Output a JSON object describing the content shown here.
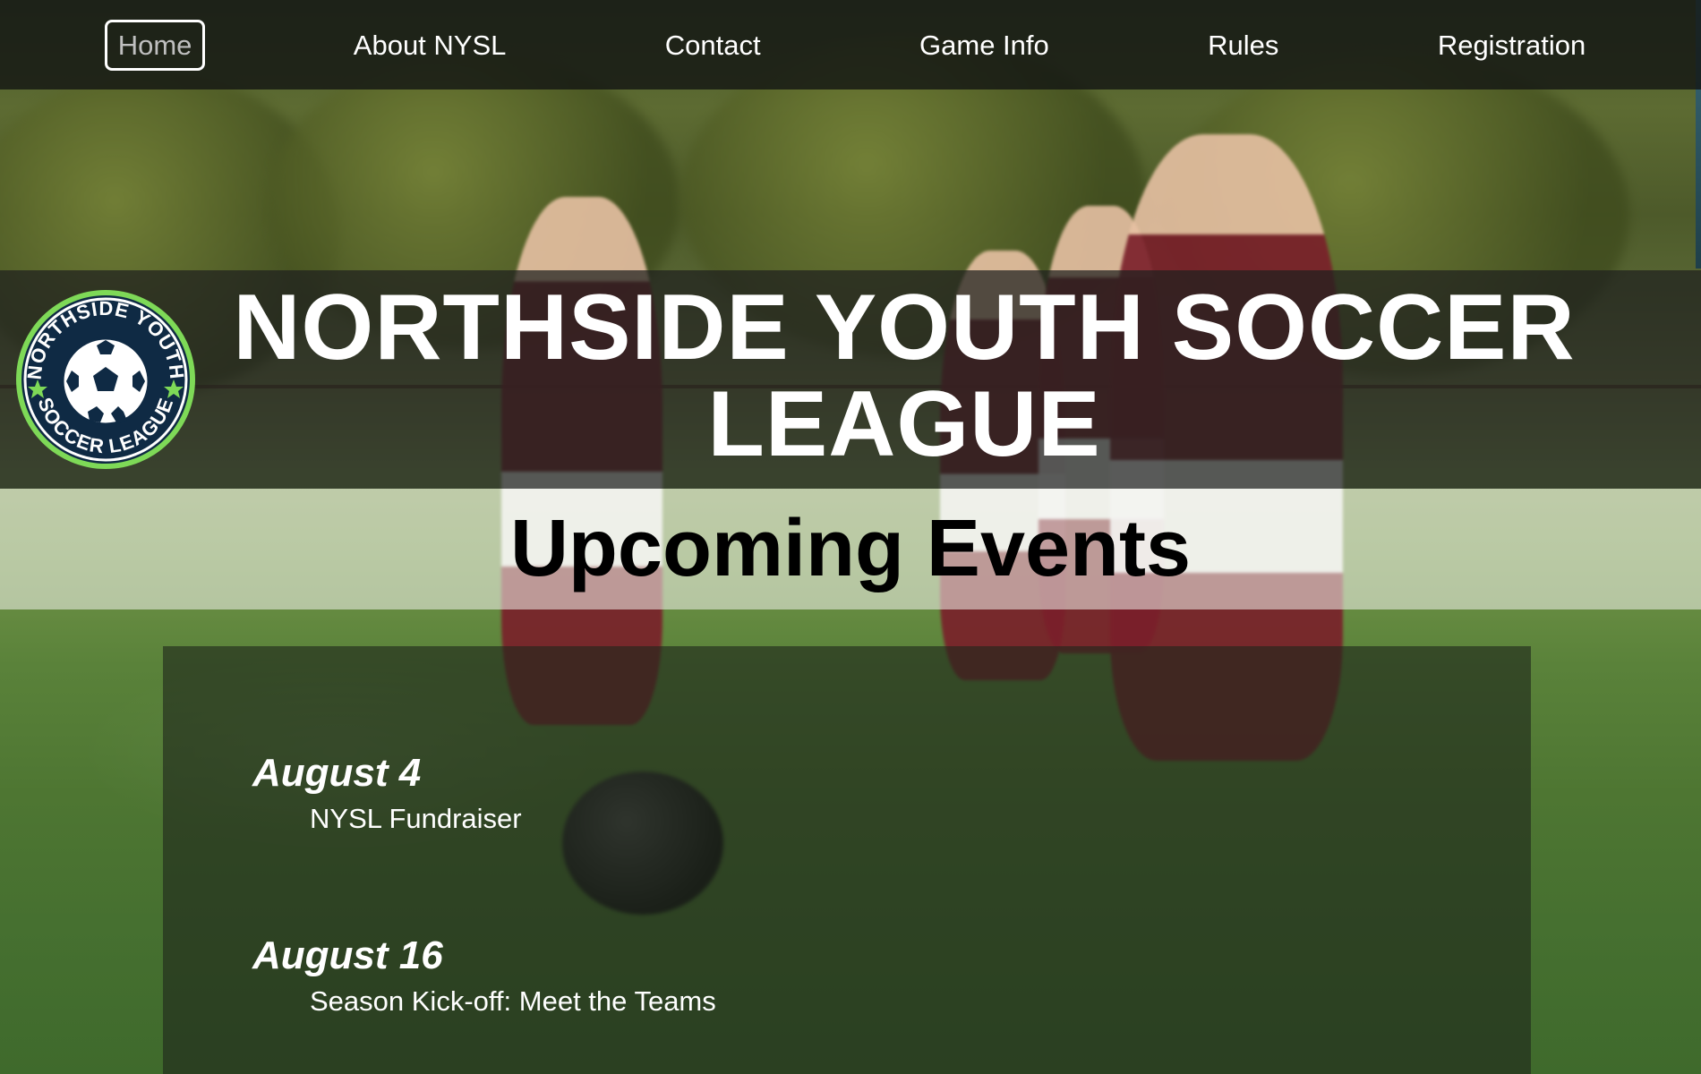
{
  "nav": {
    "items": [
      {
        "label": "Home",
        "active": true
      },
      {
        "label": "About NYSL"
      },
      {
        "label": "Contact"
      },
      {
        "label": "Game Info"
      },
      {
        "label": "Rules"
      },
      {
        "label": "Registration"
      }
    ]
  },
  "header": {
    "title": "NORTHSIDE YOUTH SOCCER LEAGUE",
    "logo": {
      "text_top": "NORTHSIDE YOUTH",
      "text_bottom": "SOCCER LEAGUE",
      "icon": "soccer-ball-icon"
    }
  },
  "events": {
    "heading": "Upcoming Events",
    "items": [
      {
        "date": "August 4",
        "name": "NYSL Fundraiser"
      },
      {
        "date": "August 16",
        "name": "Season Kick-off: Meet the Teams"
      }
    ]
  },
  "colors": {
    "nav_bg": "#141614",
    "logo_green": "#7ed957",
    "logo_navy": "#0f2a44",
    "jersey_maroon": "#7a1f2a"
  }
}
